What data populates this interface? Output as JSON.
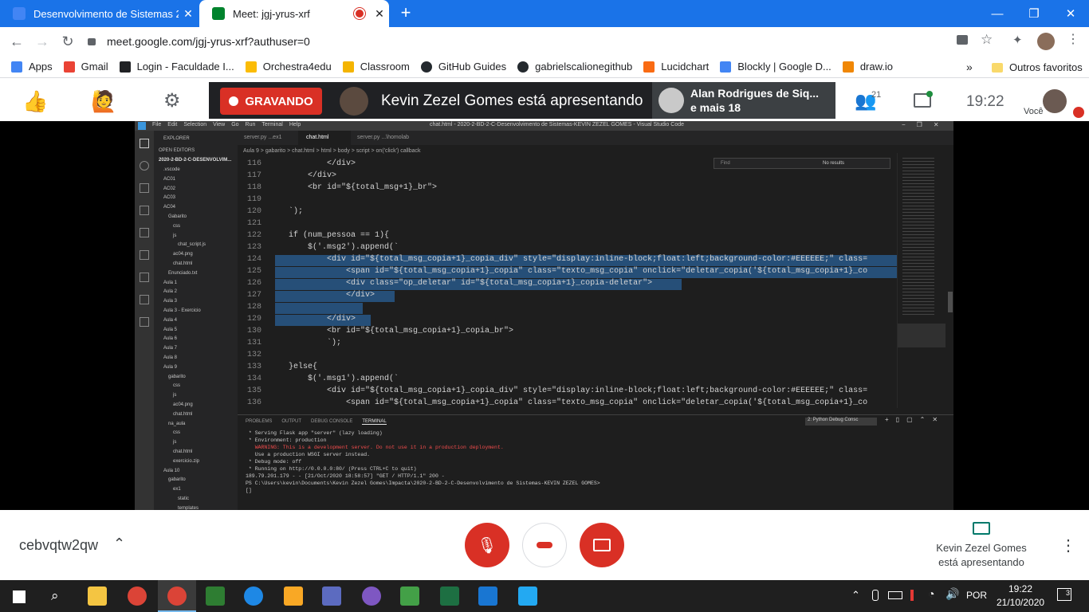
{
  "browser": {
    "tabs": [
      {
        "title": "Desenvolvimento de Sistemas 20",
        "close": "✕",
        "color": "#4285f4"
      },
      {
        "title": "Meet: jgj-yrus-xrf",
        "close": "✕",
        "color": "#00832d"
      }
    ],
    "new_tab": "+",
    "window_controls": [
      "—",
      "❐",
      "✕"
    ],
    "url": "meet.google.com/jgj-yrus-xrf?authuser=0",
    "bookmarks": [
      {
        "label": "Apps",
        "color": "#4285f4"
      },
      {
        "label": "Gmail",
        "color": "#ea4335"
      },
      {
        "label": "Login - Faculdade I...",
        "color": "#202124"
      },
      {
        "label": "Orchestra4edu",
        "color": "#fbbc05"
      },
      {
        "label": "Classroom",
        "color": "#f4b400"
      },
      {
        "label": "GitHub Guides",
        "color": "#24292e"
      },
      {
        "label": "gabrielscalionegithub",
        "color": "#24292e"
      },
      {
        "label": "Lucidchart",
        "color": "#f96b13"
      },
      {
        "label": "Blockly | Google D...",
        "color": "#4285f4"
      },
      {
        "label": "draw.io",
        "color": "#f08705"
      }
    ],
    "more_bookmarks": "»",
    "other_favorites": "Outros favoritos"
  },
  "meet": {
    "recording_label": "GRAVANDO",
    "presenter_banner": "Kevin Zezel Gomes está apresentando",
    "participants_name": "Alan Rodrigues de Siq...",
    "participants_more": "e mais 18",
    "participants_count": "21",
    "clock": "19:22",
    "self_label": "Você",
    "meeting_code": "cebvqtw2qw",
    "presenting_line1": "Kevin Zezel Gomes",
    "presenting_line2": "está apresentando"
  },
  "vscode": {
    "window_title": "chat.html - 2020-2-BD-2-C-Desenvolvimento de Sistemas-KEVIN ZEZEL GOMES - Visual Studio Code",
    "menu": [
      "File",
      "Edit",
      "Selection",
      "View",
      "Go",
      "Run",
      "Terminal",
      "Help"
    ],
    "explorer_title": "EXPLORER",
    "open_editors": "OPEN EDITORS",
    "workspace": "2020-2-BD-2-C-DESENVOLVIM...",
    "tree": [
      ".vscode",
      "AC01",
      "AC02",
      "AC03",
      "AC04",
      "Gabarito",
      "css",
      "js",
      "chat_script.js",
      "ac04.png",
      "chat.html",
      "Enunciado.txt",
      "Aula 1",
      "Aula 2",
      "Aula 3",
      "Aula 3 - Exercicio",
      "Aula 4",
      "Aula 5",
      "Aula 6",
      "Aula 7",
      "Aula 8",
      "Aula 9",
      "gabarito",
      "css",
      "js",
      "ac04.png",
      "chat.html",
      "na_aula",
      "css",
      "js",
      "chat.html",
      "exercicio.zip",
      "Aula 10",
      "gabarito",
      "ex1",
      "static",
      "templates"
    ],
    "editor_tabs": [
      "server.py ...ex1",
      "chat.html",
      "server.py ...\\homolab"
    ],
    "breadcrumb": "Aula 9 > gabarito > chat.html > html > body > script > on('click') callback",
    "find_placeholder": "Find",
    "find_result": "No results",
    "code_lines": [
      {
        "n": "116",
        "t": "            </div>"
      },
      {
        "n": "117",
        "t": "        </div>"
      },
      {
        "n": "118",
        "t": "        <br id=\"${total_msg+1}_br\">"
      },
      {
        "n": "119",
        "t": ""
      },
      {
        "n": "120",
        "t": "    `);"
      },
      {
        "n": "121",
        "t": ""
      },
      {
        "n": "122",
        "t": "    if (num_pessoa == 1){"
      },
      {
        "n": "123",
        "t": "        $('.msg2').append(`"
      },
      {
        "n": "124",
        "t": "            <div id=\"${total_msg_copia+1}_copia_div\" style=\"display:inline-block;float:left;background-color:#EEEEEE;\" class="
      },
      {
        "n": "125",
        "t": "                <span id=\"${total_msg_copia+1}_copia\" class=\"texto_msg_copia\" onclick=\"deletar_copia('${total_msg_copia+1}_co"
      },
      {
        "n": "126",
        "t": "                <div class=\"op_deletar\" id=\"${total_msg_copia+1}_copia-deletar\">"
      },
      {
        "n": "127",
        "t": "                </div>"
      },
      {
        "n": "128",
        "t": ""
      },
      {
        "n": "129",
        "t": "            </div>"
      },
      {
        "n": "130",
        "t": "            <br id=\"${total_msg_copia+1}_copia_br\">"
      },
      {
        "n": "131",
        "t": "            `);"
      },
      {
        "n": "132",
        "t": ""
      },
      {
        "n": "133",
        "t": "    }else{"
      },
      {
        "n": "134",
        "t": "        $('.msg1').append(`"
      },
      {
        "n": "135",
        "t": "            <div id=\"${total_msg_copia+1}_copia_div\" style=\"display:inline-block;float:left;background-color:#EEEEEE;\" class="
      },
      {
        "n": "136",
        "t": "                <span id=\"${total_msg_copia+1}_copia\" class=\"texto_msg_copia\" onclick=\"deletar_copia('${total_msg_copia+1}_co"
      }
    ],
    "panel_tabs": [
      "PROBLEMS",
      "OUTPUT",
      "DEBUG CONSOLE",
      "TERMINAL"
    ],
    "terminal_select": "2: Python Debug Consc",
    "terminal_lines": [
      {
        "t": " * Serving Flask app \"server\" (lazy loading)",
        "c": "#cccccc"
      },
      {
        "t": " * Environment: production",
        "c": "#cccccc"
      },
      {
        "t": "   WARNING: This is a development server. Do not use it in a production deployment.",
        "c": "#f14c4c"
      },
      {
        "t": "   Use a production WSGI server instead.",
        "c": "#cccccc"
      },
      {
        "t": " * Debug mode: off",
        "c": "#cccccc"
      },
      {
        "t": " * Running on http://0.0.0.0:80/ (Press CTRL+C to quit)",
        "c": "#cccccc"
      },
      {
        "t": "189.79.201.179 - - [21/Oct/2020 18:58:57] \"GET / HTTP/1.1\" 200 -",
        "c": "#cccccc"
      },
      {
        "t": "PS C:\\Users\\kevin\\Documents\\Kevin Zezel Gomes\\Impacta\\2020-2-BD-2-C-Desenvolvimento de Sistemas-KEVIN ZEZEL GOMES>",
        "c": "#cccccc"
      },
      {
        "t": "[]",
        "c": "#cccccc"
      }
    ]
  },
  "taskbar": {
    "lang": "POR",
    "time": "19:22",
    "date": "21/10/2020",
    "notif_count": "3"
  }
}
